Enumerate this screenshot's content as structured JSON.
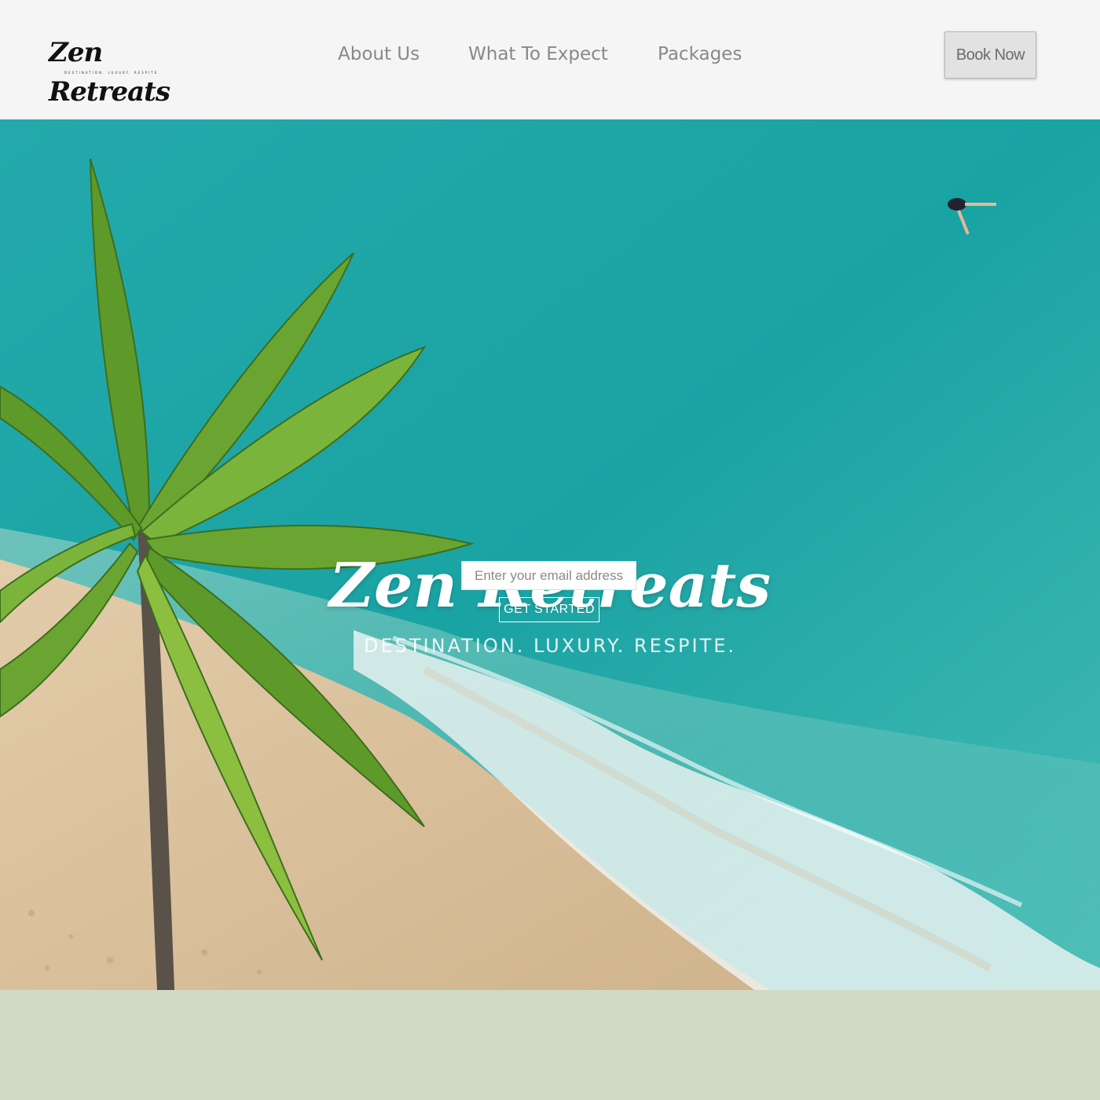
{
  "header": {
    "logo_text": "Zen Retreats",
    "logo_tagline": "DESTINATION. LUXURY. RESPITE.",
    "nav": [
      {
        "label": "About Us"
      },
      {
        "label": "What To Expect"
      },
      {
        "label": "Packages"
      }
    ],
    "book_label": "Book Now"
  },
  "hero": {
    "title": "Zen Retreats",
    "subtitle": "DESTINATION. LUXURY. RESPITE.",
    "email_placeholder": "Enter your email address",
    "cta_label": "GET STARTED",
    "background": "aerial-beach-palm-tree-image"
  },
  "colors": {
    "header_bg": "#f5f5f5",
    "ocean": "#19a7a8",
    "sand": "#dcc6a2",
    "band": "#cfdac7",
    "nav_text": "#888888"
  }
}
